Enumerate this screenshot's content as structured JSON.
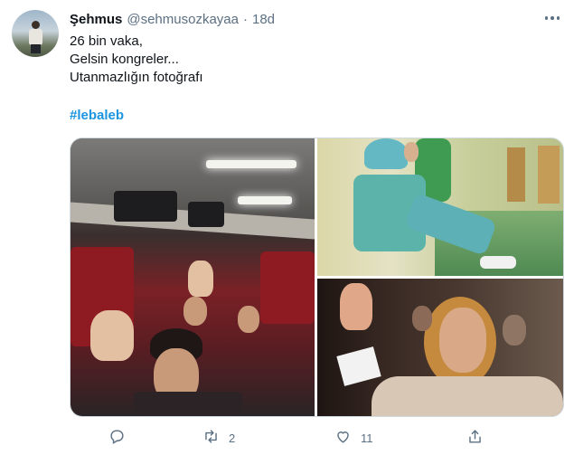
{
  "tweet": {
    "author": {
      "display_name": "Şehmus",
      "handle": "@sehmusozkayaa",
      "separator": "·",
      "time": "18d"
    },
    "text_lines": [
      "26 bin vaka,",
      "Gelsin kongreler...",
      "Utanmazlığın fotoğrafı"
    ],
    "hashtag": "#lebaleb"
  },
  "actions": {
    "reply": {
      "icon": "reply-icon",
      "count": ""
    },
    "retweet": {
      "icon": "retweet-icon",
      "count": "2"
    },
    "like": {
      "icon": "heart-icon",
      "count": "11"
    },
    "share": {
      "icon": "share-icon",
      "count": ""
    }
  },
  "colors": {
    "text": "#0f1419",
    "secondary": "#5b7083",
    "link": "#1b95e0",
    "border": "#cfd9de"
  }
}
